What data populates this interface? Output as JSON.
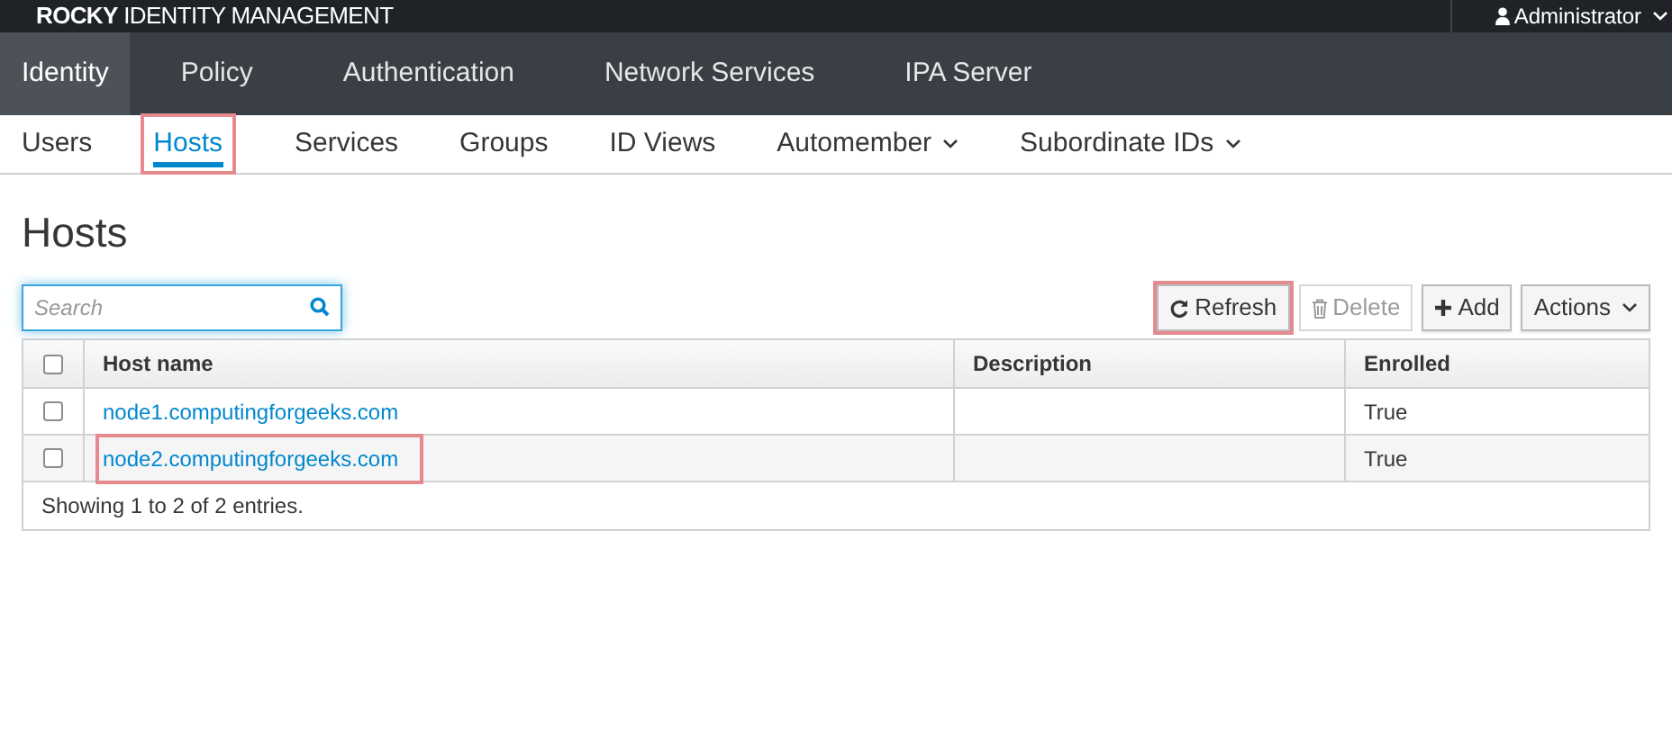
{
  "brand": "**ROCKY** IDENTITY MANAGEMENT",
  "user_menu": {
    "label": "Administrator"
  },
  "main_tabs": [
    {
      "label": "Identity",
      "selected": true
    },
    {
      "label": "Policy",
      "selected": false
    },
    {
      "label": "Authentication",
      "selected": false
    },
    {
      "label": "Network Services",
      "selected": false
    },
    {
      "label": "IPA Server",
      "selected": false
    }
  ],
  "sub_tabs": [
    {
      "label": "Users",
      "selected": false,
      "dropdown": false,
      "highlighted": false
    },
    {
      "label": "Hosts",
      "selected": true,
      "dropdown": false,
      "highlighted": true
    },
    {
      "label": "Services",
      "selected": false,
      "dropdown": false,
      "highlighted": false
    },
    {
      "label": "Groups",
      "selected": false,
      "dropdown": false,
      "highlighted": false
    },
    {
      "label": "ID Views",
      "selected": false,
      "dropdown": false,
      "highlighted": false
    },
    {
      "label": "Automember",
      "selected": false,
      "dropdown": true,
      "highlighted": false
    },
    {
      "label": "Subordinate IDs",
      "selected": false,
      "dropdown": true,
      "highlighted": false
    }
  ],
  "page_title": "Hosts",
  "search": {
    "placeholder": "Search"
  },
  "buttons": [
    {
      "kind": "refresh",
      "label": "Refresh",
      "disabled": false,
      "highlighted": true
    },
    {
      "kind": "delete",
      "label": "Delete",
      "disabled": true,
      "highlighted": false
    },
    {
      "kind": "add",
      "label": "Add",
      "disabled": false,
      "highlighted": false
    },
    {
      "kind": "actions",
      "label": "Actions",
      "disabled": false,
      "highlighted": false
    }
  ],
  "table": {
    "select_all": {
      "checked": false
    },
    "columns": [
      "Host name",
      "Description",
      "Enrolled"
    ],
    "rows": [
      {
        "checked": false,
        "host": "node1.computingforgeeks.com",
        "enrolled": "True",
        "highlighted": false
      },
      {
        "checked": false,
        "host": "node2.computingforgeeks.com",
        "enrolled": "True",
        "highlighted": true
      }
    ],
    "footer": "Showing 1 to 2 of 2 entries."
  }
}
